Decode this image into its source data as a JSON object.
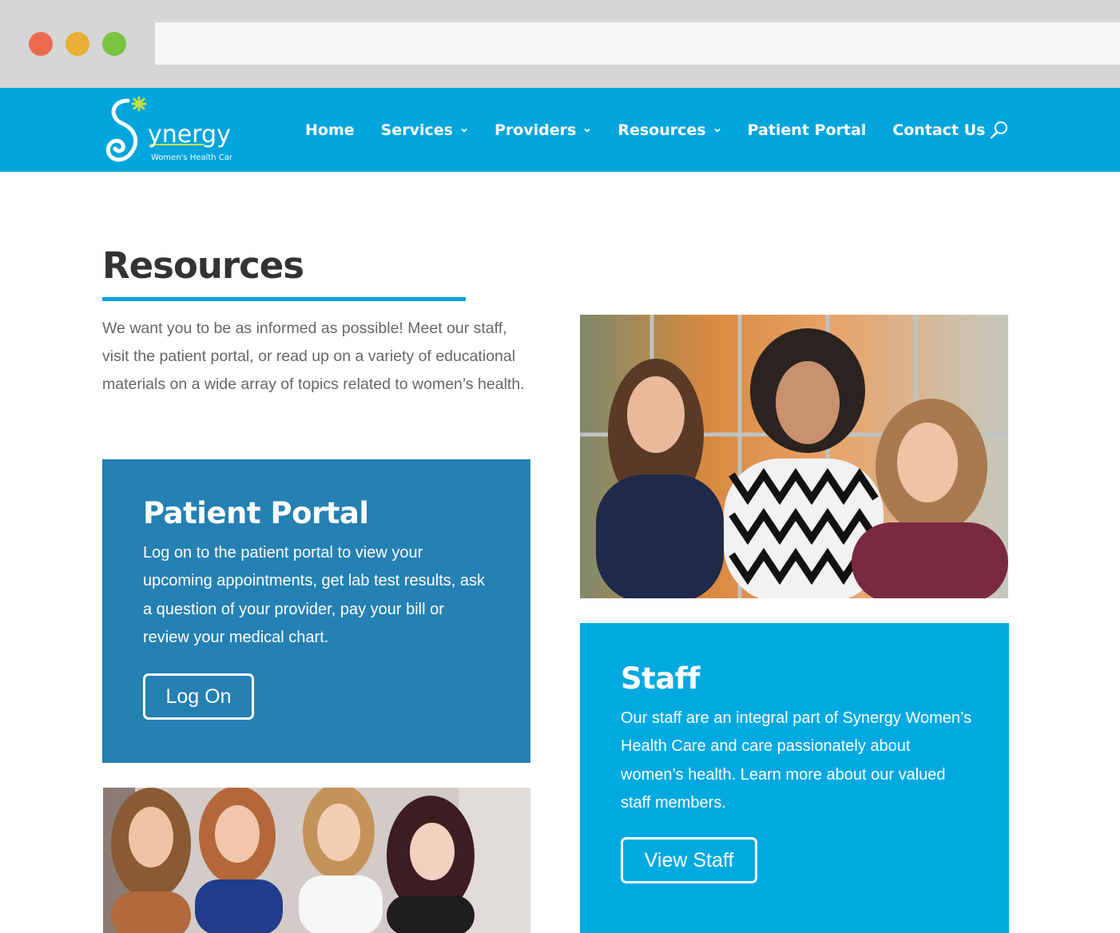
{
  "colors": {
    "header_blue": "#00a5dc",
    "portal_blue": "#2580b3",
    "staff_blue": "#00a9e0",
    "heading": "#333333",
    "body_text": "#666666"
  },
  "browser": {
    "window_controls": [
      "close",
      "minimize",
      "maximize"
    ]
  },
  "header": {
    "logo": {
      "name": "ynergy",
      "tagline": "Women's Health Care"
    },
    "nav": [
      {
        "label": "Home",
        "has_dropdown": false
      },
      {
        "label": "Services",
        "has_dropdown": true
      },
      {
        "label": "Providers",
        "has_dropdown": true
      },
      {
        "label": "Resources",
        "has_dropdown": true
      },
      {
        "label": "Patient Portal",
        "has_dropdown": false
      },
      {
        "label": "Contact Us",
        "has_dropdown": false
      }
    ],
    "search_icon": "search-icon"
  },
  "main": {
    "title": "Resources",
    "intro": "We want you to be as informed as possible! Meet our staff, visit the patient portal, or read up on a variety of educational materials on a wide array of topics related to women’s health.",
    "portal_card": {
      "title": "Patient Portal",
      "text": "Log on to the patient portal to view your upcoming appointments, get lab test results, ask a question of your provider, pay your bill or review your medical chart.",
      "button": "Log On"
    },
    "staff_card": {
      "title": "Staff",
      "text": "Our staff are an integral part of Synergy Women’s Health Care and care passionately about women’s health. Learn more about our valued staff members.",
      "button": "View Staff"
    }
  }
}
